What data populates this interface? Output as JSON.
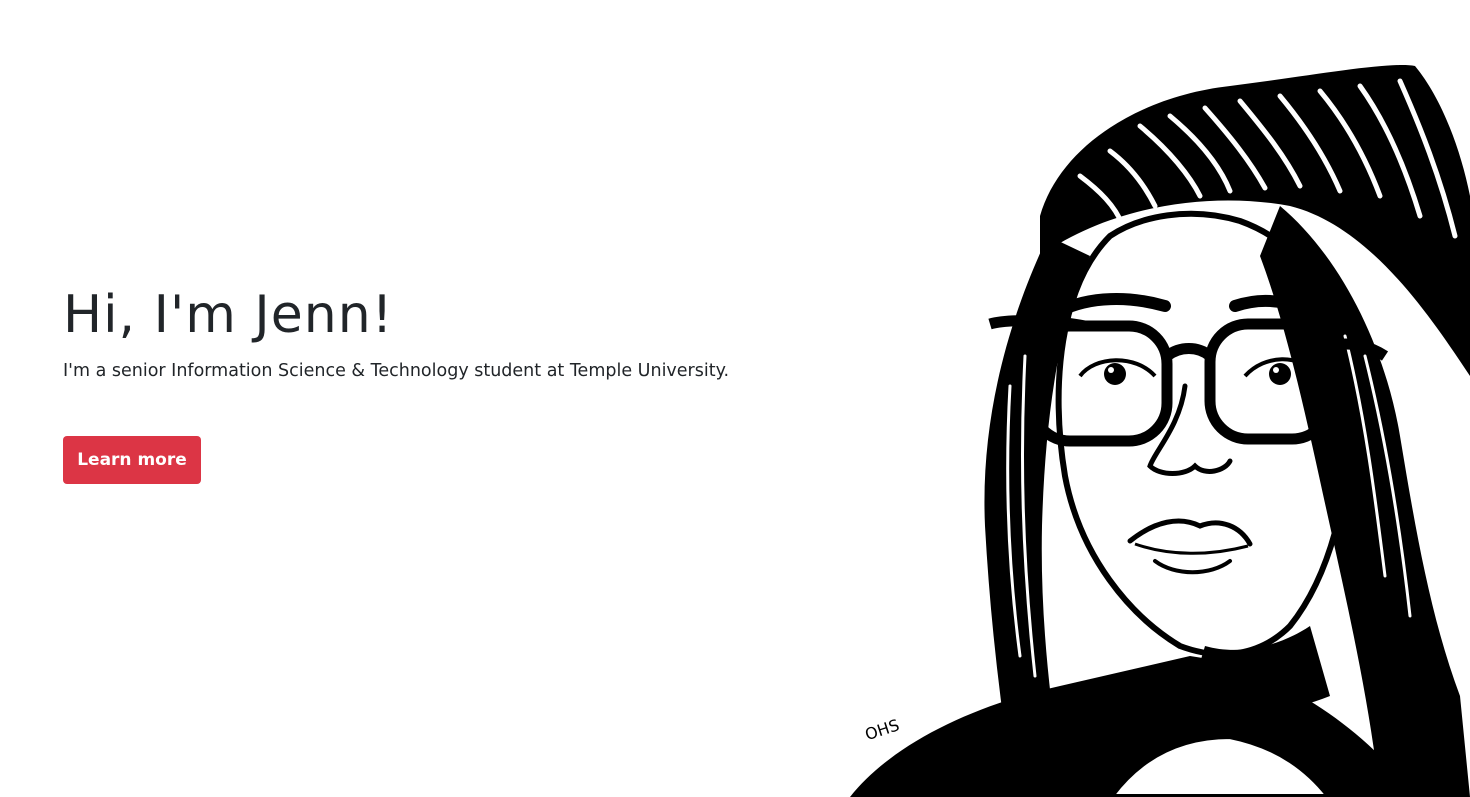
{
  "hero": {
    "title": "Hi, I'm Jenn!",
    "subtitle": "I'm a senior Information Science & Technology student at Temple University.",
    "cta_label": "Learn more"
  },
  "portrait": {
    "signature": "OHS"
  },
  "colors": {
    "accent": "#dc3545",
    "text": "#212529",
    "background": "#ffffff",
    "ink": "#000000"
  }
}
